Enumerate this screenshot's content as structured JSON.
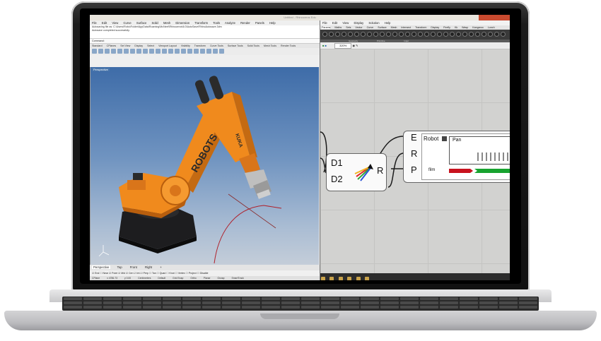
{
  "window": {
    "title": "Untitled - Rhinoceros Edu",
    "accent": "#c94a2f"
  },
  "rhino": {
    "menu": [
      "File",
      "Edit",
      "View",
      "Curve",
      "Surface",
      "Solid",
      "Mesh",
      "Dimension",
      "Transform",
      "Tools",
      "Analyze",
      "Render",
      "Panels",
      "Help"
    ],
    "command_history": [
      "Autosaving file as: C:\\Users\\Robo\\Folder\\AppData\\Roaming\\McNeel\\Rhinoceros\\6.0\\AutoSave\\RhinoAutosave.3dm",
      "Autosave completed successfully."
    ],
    "command_prompt": "Command:",
    "toolbar_tabs": [
      "Standard",
      "CPlanes",
      "Set View",
      "Display",
      "Select",
      "Viewport Layout",
      "Visibility",
      "Transform",
      "Curve Tools",
      "Surface Tools",
      "Solid Tools",
      "Mesh Tools",
      "Render Tools"
    ],
    "viewport_label": "Perspective",
    "viewport_tabs": [
      "Perspective",
      "Top",
      "Front",
      "Right",
      "+"
    ],
    "osnaps": [
      "End",
      "Near",
      "Point",
      "Mid",
      "Cen",
      "Int",
      "Perp",
      "Tan",
      "Quad",
      "Knot",
      "Vertex",
      "Project",
      "Disable"
    ],
    "status_items": [
      "CPlane",
      "x 4786.73",
      "y 0.00",
      "Centimeters",
      "Default",
      "Grid Snap",
      "Ortho",
      "Planar",
      "Osnap",
      "SmartTrack"
    ]
  },
  "grasshopper": {
    "menu": [
      "File",
      "Edit",
      "View",
      "Display",
      "Solution",
      "Help"
    ],
    "tabs": [
      "Params",
      "Maths",
      "Sets",
      "Vector",
      "Curve",
      "Surface",
      "Mesh",
      "Intersect",
      "Transform",
      "Display",
      "Firefly",
      "Kk",
      "Wasp",
      "Kangaroo",
      "Lunch"
    ],
    "active_tab": "Params",
    "ribbon_groups": [
      "Geometry",
      "Primitive",
      "Input"
    ],
    "zoom": "320%",
    "component_left": {
      "inputs": [
        "D1",
        "D2"
      ],
      "output": "R"
    },
    "component_right": {
      "inputs": [
        "E",
        "R",
        "P"
      ],
      "robot_label": "Robot",
      "pan_label": "Pan",
      "film_label": "film"
    },
    "colors": {
      "wire": "#1c1c1c",
      "bar_red": "#c8121e",
      "bar_green": "#17a32f"
    }
  },
  "robot": {
    "brand": "ROBOTS.IO",
    "arm_brand": "KUKA",
    "color": "#f08a1d"
  }
}
